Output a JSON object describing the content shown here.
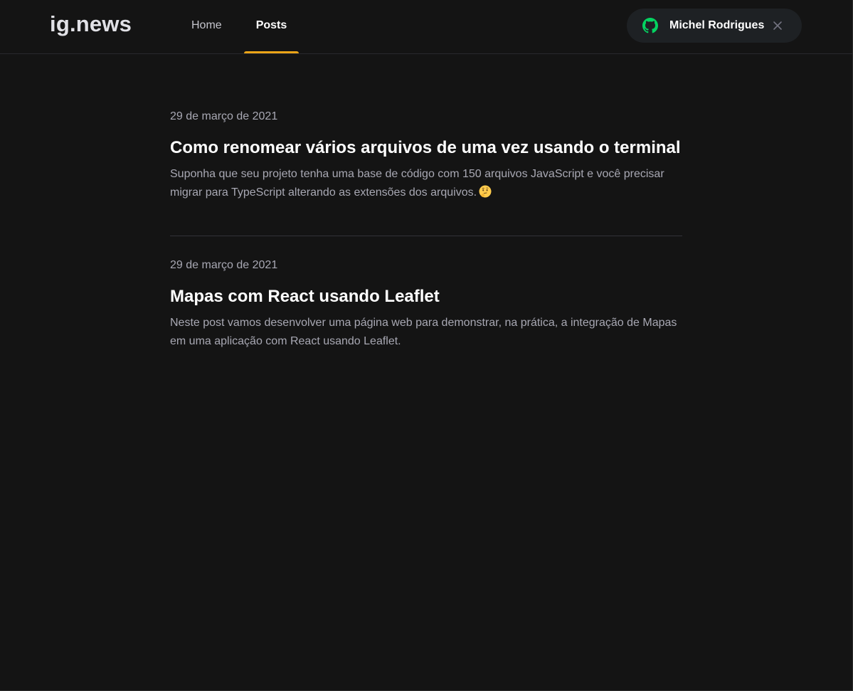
{
  "header": {
    "logo": "ig.news",
    "nav": [
      {
        "label": "Home",
        "active": false
      },
      {
        "label": "Posts",
        "active": true
      }
    ],
    "user": {
      "name": "Michel Rodrigues",
      "icon": "github-icon",
      "close_icon": "close-icon"
    }
  },
  "posts": [
    {
      "date": "29 de março de 2021",
      "title": "Como renomear vários arquivos de uma vez usando o terminal",
      "excerpt": "Suponha que seu projeto tenha uma base de código com 150 arquivos JavaScript e você precisar migrar para TypeScript alterando as extensões dos arquivos.",
      "excerpt_emoji": "thinking-face-emoji"
    },
    {
      "date": "29 de março de 2021",
      "title": "Mapas com React usando Leaflet",
      "excerpt": "Neste post vamos desenvolver uma página web para demonstrar, na prática, a integração de Mapas em uma aplicação com React usando Leaflet."
    }
  ],
  "colors": {
    "background": "#141414",
    "accent": "#eba417",
    "github_green": "#04d361",
    "text_muted": "#a8a8b3"
  }
}
